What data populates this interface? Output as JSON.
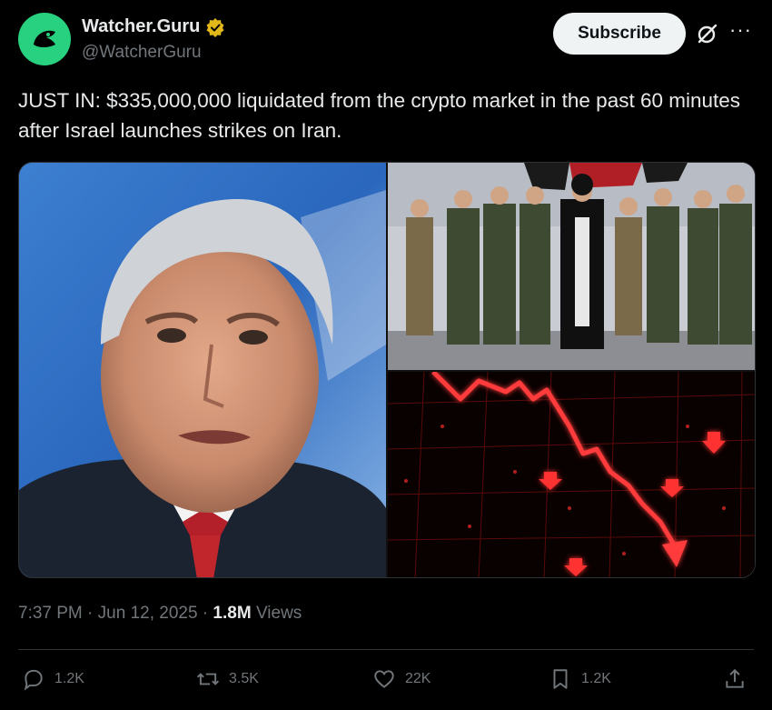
{
  "author": {
    "display_name": "Watcher.Guru",
    "handle": "@WatcherGuru",
    "verified_icon": "verified-gold-badge",
    "avatar_color": "#27d17f"
  },
  "header": {
    "subscribe_label": "Subscribe",
    "grok_icon": "grok-icon",
    "more_icon": "more-icon"
  },
  "post": {
    "text": "JUST IN: $335,000,000 liquidated from the crypto market in the past 60 minutes after Israel launches strikes on Iran."
  },
  "media": {
    "images": [
      {
        "name": "portrait-photo"
      },
      {
        "name": "military-group-photo"
      },
      {
        "name": "market-crash-graphic"
      }
    ]
  },
  "meta": {
    "time": "7:37 PM",
    "separator": " · ",
    "date": "Jun 12, 2025",
    "views_count": "1.8M",
    "views_label": "Views"
  },
  "actions": {
    "replies": "1.2K",
    "reposts": "3.5K",
    "likes": "22K",
    "bookmarks": "1.2K"
  },
  "colors": {
    "background": "#000000",
    "text_primary": "#e7e9ea",
    "text_secondary": "#71767b",
    "badge_gold": "#e2b719"
  }
}
